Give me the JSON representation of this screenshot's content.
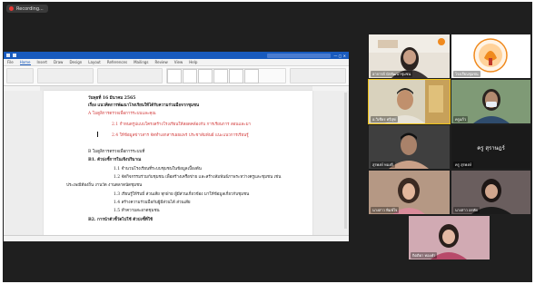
{
  "recording": {
    "label": "Recording..."
  },
  "word": {
    "title": "",
    "tabs": [
      "File",
      "Home",
      "Insert",
      "Draw",
      "Design",
      "Layout",
      "References",
      "Mailings",
      "Review",
      "View",
      "Help"
    ],
    "active_tab": "Home",
    "lines": [
      {
        "text": "วันพุธที่ 16 มีนาคม 2565",
        "style": "bold"
      },
      {
        "text": "เรื่อง แนวคิดการพัฒนาโรงเรียนให้ได้รับความร่วมมือจากชุมชน",
        "style": "bold"
      },
      {
        "text": "A โมดูลิการตรวจเพื่อการระบบและคุณ",
        "style": "red"
      },
      {
        "text": "2.1 กำหนดรูปแบบโครงสร้างโรงเรียนให้สอดคล้องกับ การเรียนการ สอนและมา",
        "style": "red"
      },
      {
        "text": "2.4 ให้ข้อมูลข่าวสาร จัดทำเอกสารเผยแพร่ ประชาสัมพันธ์ แนะแนวการเรียนรู้",
        "style": "red"
      },
      {
        "text": "B โมดูลิการตรวจเพื่อการระบบที่",
        "style": "normal"
      },
      {
        "text": "B1. ตัวบ่งชี้การในเชิงปริมาณ",
        "style": "bold"
      },
      {
        "text": "1.1 จำนวนโรงเรียนที่ระบบชุมชนในข้อมูลเบื้องต้น",
        "style": "normal"
      },
      {
        "text": "1.2 จัดกิจกรรมร่วมกับชุมชน เพื่อสร้างเครือข่าย และสร้างสัมพันธ์ภาพระหว่างครูและชุมชน เช่น",
        "style": "normal"
      },
      {
        "text": "ประเพณีท้องถิ่น งานวัด งานตลาดนัดชุมชน",
        "style": "normal"
      },
      {
        "text": "1.3 เรียนรู้ให้รับมี่ ส่วนเสีย ทุกฝ่าย ผู้มีส่วนเกี่ยวข้อง มาให้ข้อมูลเกี่ยวกับชุมชน",
        "style": "normal"
      },
      {
        "text": "1.4 สร้างความร่วมมือกับผู้มีส่วนได้ ส่วนเสีย",
        "style": "normal"
      },
      {
        "text": "1.5 ทำความสะอาดชุมชน",
        "style": "normal"
      },
      {
        "text": "B2. การนำตัวชี้วัดไปใช้ ตัวบ่งชี้ที่ใช้",
        "style": "bold"
      }
    ]
  },
  "participants": [
    {
      "id": "presenter",
      "name": "อาจารย์ นักพัฒนาชุมชน",
      "bg": "#6b5a4a"
    },
    {
      "id": "logo",
      "name": "โรงเรียนชุมชน",
      "bg": "#ffffff"
    },
    {
      "id": "man",
      "name": "อ.วิเชียร ศรีสุข",
      "bg": "#8a8a6a"
    },
    {
      "id": "mask",
      "name": "ครูแก้ว",
      "bg": "#6d8f6b"
    },
    {
      "id": "guy",
      "name": "สุรพงษ์ ทองดี",
      "bg": "#3a3a3a"
    },
    {
      "id": "text",
      "name": "ครู สุรพงษ์",
      "bg": "#1a1a1a"
    },
    {
      "id": "teen",
      "name": "นางสาว พิมพ์ใจ",
      "bg": "#9a7f6a"
    },
    {
      "id": "woman",
      "name": "นางสาว อรทัย",
      "bg": "#5a5050"
    },
    {
      "id": "pink",
      "name": "กิตติยา ทองคำ",
      "bg": "#c59fa8"
    }
  ],
  "text_tile": {
    "label": "ครู สุราษฎร์"
  },
  "colors": {
    "word_blue": "#185abd",
    "red_text": "#d23a3a",
    "logo_orange": "#f08a1e"
  }
}
